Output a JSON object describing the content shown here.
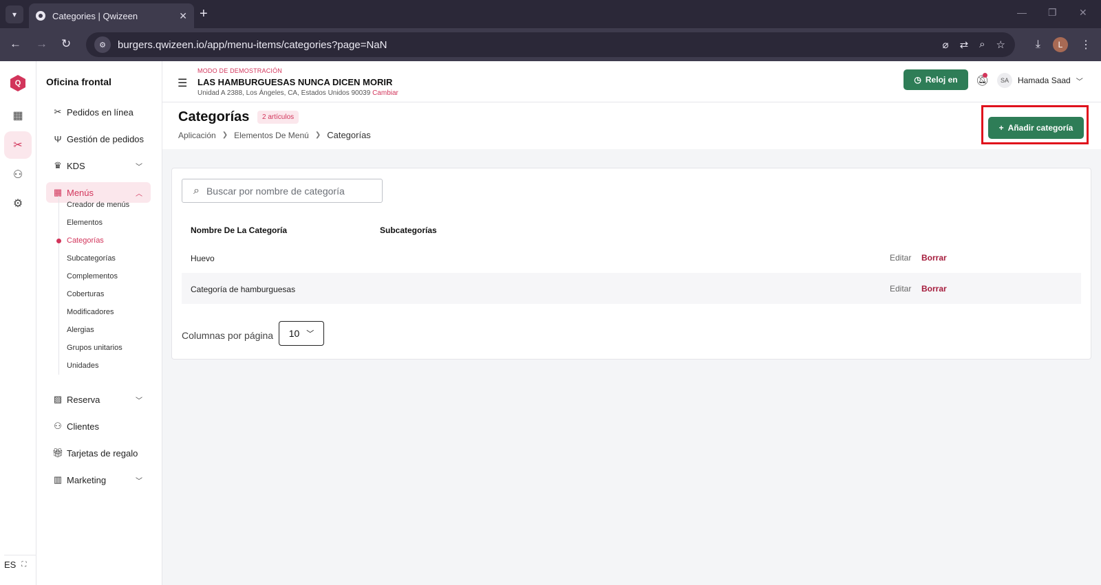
{
  "browser": {
    "tab_title": "Categories | Qwizeen",
    "url": "burgers.qwizeen.io/app/menu-items/categories?page=NaN",
    "profile_initial": "L"
  },
  "rail": {
    "logo": "Q",
    "language": "ES",
    "items": [
      "dashboard-icon",
      "menu-icon",
      "org-icon",
      "settings-icon"
    ]
  },
  "sidebar": {
    "title": "Oficina frontal",
    "items": [
      {
        "label": "Pedidos en línea",
        "icon": "fork-knife-icon"
      },
      {
        "label": "Gestión de pedidos",
        "icon": "utensils-icon"
      },
      {
        "label": "KDS",
        "icon": "chef-hat-icon"
      },
      {
        "label": "Menús",
        "icon": "grid-icon"
      },
      {
        "label": "Reserva",
        "icon": "table-icon"
      },
      {
        "label": "Clientes",
        "icon": "users-icon"
      },
      {
        "label": "Tarjetas de regalo",
        "icon": "gift-icon"
      },
      {
        "label": "Marketing",
        "icon": "bar-chart-icon"
      }
    ],
    "submenu": [
      "Creador de menús",
      "Elementos",
      "Categorías",
      "Subcategorías",
      "Complementos",
      "Coberturas",
      "Modificadores",
      "Alergias",
      "Grupos unitarios",
      "Unidades"
    ]
  },
  "header": {
    "demo_mode": "MODO DE DEMOSTRACIÓN",
    "store_name": "LAS HAMBURGUESAS NUNCA DICEN MORIR",
    "address": "Unidad A 2388, Los Ángeles, CA, Estados Unidos 90039",
    "change_link": "Cambiar",
    "clock_in": "Reloj en",
    "user_initials": "SA",
    "user_name": "Hamada Saad"
  },
  "page": {
    "title": "Categorías",
    "count_badge": "2 artículos",
    "breadcrumb": [
      "Aplicación",
      "Elementos De Menú",
      "Categorías"
    ],
    "add_button": "Añadir categoría"
  },
  "table": {
    "search_placeholder": "Buscar por nombre de categoría",
    "columns": [
      "Nombre De La Categoría",
      "Subcategorías"
    ],
    "rows": [
      {
        "name": "Huevo",
        "subcategories": ""
      },
      {
        "name": "Categoría de hamburguesas",
        "subcategories": ""
      }
    ],
    "edit_label": "Editar",
    "delete_label": "Borrar",
    "rows_per_page_label": "Columnas por página",
    "rows_per_page_value": "10"
  },
  "colors": {
    "accent": "#d2355b",
    "primary_button": "#2e7d57",
    "highlight_box": "#e0111c"
  }
}
